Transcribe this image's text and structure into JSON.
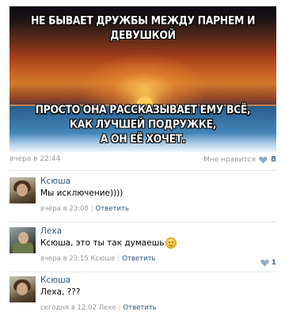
{
  "post": {
    "image": {
      "caption_top": "НЕ БЫВАЕТ ДРУЖБЫ МЕЖДУ ПАРНЕМ И ДЕВУШКОЙ",
      "caption_bottom": [
        "ПРОСТО ОНА РАССКАЗЫВАЕТ ЕМУ ВСЁ,",
        "КАК ЛУЧШЕЙ ПОДРУЖКЕ,",
        "А ОН ЕЁ ХОЧЕТ."
      ]
    },
    "date": "вчера в 22:44",
    "like_label": "Мне нравится",
    "like_count": "8",
    "like_icon": "heart-icon",
    "like_color": "#8eabc7"
  },
  "comments": [
    {
      "author": "Ксюша",
      "text": "Мы исключение))))",
      "time": "вчера в 23:08",
      "reply_to": "",
      "reply_label": "Ответить",
      "likes": ""
    },
    {
      "author": "Леха",
      "text": "Ксюша, это ты так думаешь",
      "emoji": "smile-emoji",
      "time": "вчера в 23:15",
      "reply_to": "Ксюше",
      "reply_label": "Ответить",
      "likes": "1"
    },
    {
      "author": "Ксюша",
      "text": "Леха, ???",
      "time": "сегодня в 12:02",
      "reply_to": "Лехе",
      "reply_label": "Ответить",
      "likes": ""
    }
  ],
  "colors": {
    "link": "#2b587a",
    "meta": "#999999",
    "like_count": "#45688e"
  }
}
